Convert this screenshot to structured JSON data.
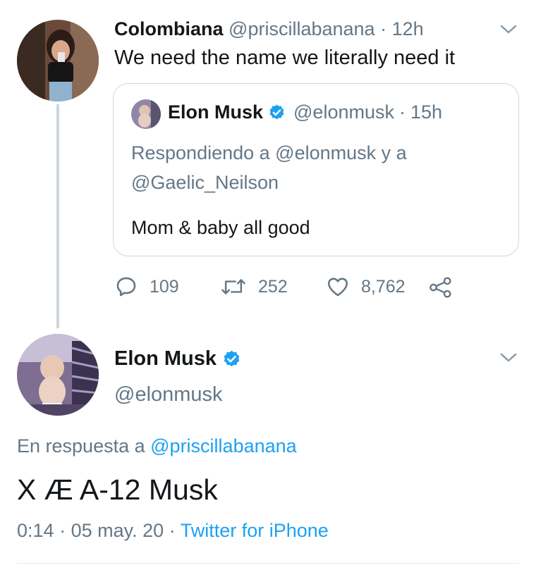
{
  "first_tweet": {
    "author_name": "Colombiana",
    "handle": "@priscillabanana",
    "separator": "·",
    "time": "12h",
    "text": "We need the name we literally need it",
    "avatar_icon": "user-photo-avatar",
    "menu_icon": "chevron-down-icon"
  },
  "quoted_tweet": {
    "author_name": "Elon Musk",
    "handle": "@elonmusk",
    "separator": "·",
    "time": "15h",
    "replying_line1": "Respondiendo a @elonmusk y a",
    "replying_line2": "@Gaelic_Neilson",
    "text": "Mom & baby all good",
    "verified_icon": "verified-badge-icon"
  },
  "actions": {
    "replies": "109",
    "retweets": "252",
    "likes": "8,762",
    "reply_icon": "reply-icon",
    "retweet_icon": "retweet-icon",
    "like_icon": "heart-icon",
    "share_icon": "share-icon"
  },
  "main_tweet": {
    "author_name": "Elon Musk",
    "handle": "@elonmusk",
    "reply_prefix": "En respuesta a",
    "reply_to": "@priscillabanana",
    "text": "X Æ A-12 Musk",
    "time": "0:14",
    "separator1": "·",
    "date": "05 may. 20",
    "separator2": "·",
    "source": "Twitter for iPhone"
  },
  "colors": {
    "accent": "#1da1f2",
    "muted": "#657786",
    "border": "#ccd6dd"
  }
}
